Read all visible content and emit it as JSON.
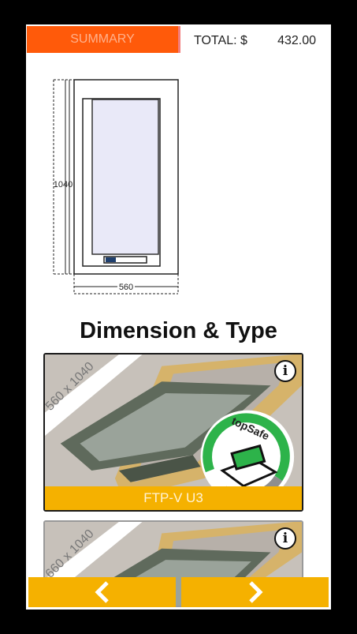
{
  "header": {
    "summary_label": "SUMMARY",
    "total_label": "TOTAL: $",
    "total_value": "432.00"
  },
  "drawing": {
    "height_label": "1040",
    "width_label": "560"
  },
  "section_title": "Dimension & Type",
  "products": [
    {
      "size": "560 x 1040",
      "name": "FTP-V U3",
      "badge": "topSafe"
    },
    {
      "size": "660 x 1040",
      "name": ""
    }
  ],
  "colors": {
    "summary_bg": "#ff5a0a",
    "accent": "#f5b100"
  },
  "icons": {
    "info": "info-icon",
    "prev": "chevron-left-icon",
    "next": "chevron-right-icon"
  }
}
